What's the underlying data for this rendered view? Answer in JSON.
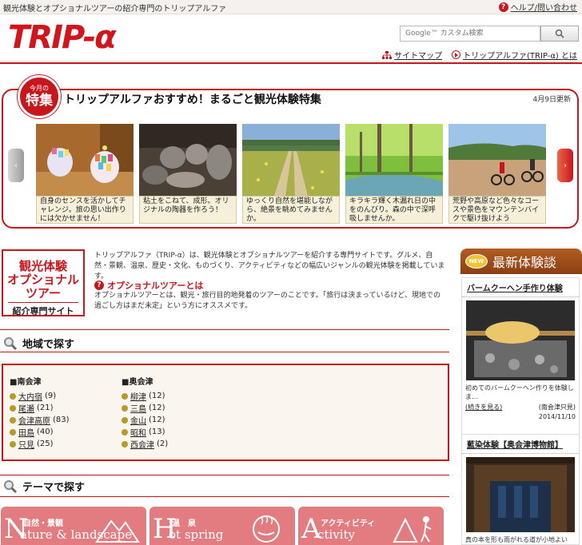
{
  "topbar": {
    "tagline": "観光体験とオプショナルツアーの紹介専門のトリップアルファ",
    "help_label": "ヘルプ/問い合わせ"
  },
  "header": {
    "logo_text": "TRIP-α",
    "search_placeholder": "Google™ カスタム検索",
    "links": [
      "サイトマップ",
      "トリップアルファ(TRIP-α) とは"
    ]
  },
  "feature": {
    "badge_small": "今月の",
    "badge_big": "特集",
    "title": "トリップアルファおすすめ！まるごと観光体験特集",
    "updated": "4月9日更新",
    "slides": [
      {
        "caption": "自身のセンスを活かしてチャレンジ。旅の思い出作りには欠かせません！"
      },
      {
        "caption": "粘土をこねて、成形。オリジナルの陶器を作ろう！"
      },
      {
        "caption": "ゆっくり自然を堪能しながら、絶景を眺めてみませんか。"
      },
      {
        "caption": "キラキラ輝く木漏れ日の中をのんびり。森の中で深呼吸しませんか。"
      },
      {
        "caption": "荒野や高原など色々なコースや景色をマウンテンバイクで駆け抜けよう"
      }
    ]
  },
  "intro": {
    "logo_lines": [
      "観光体験",
      "オプショナル",
      "ツアー",
      "紹介専門サイト"
    ],
    "text": "トリップアルファ（TRIP-α）は、観光体験とオプショナルツアーを紹介する専門サイトです。グルメ、自然・景観、温泉、歴史・文化、ものづくり、アクティビティなどの幅広いジャンルの観光体験を掲載しています。",
    "sub_title": "オプショナルツアーとは",
    "sub_text": "オプショナルツアーとは、観光・旅行目的地発着のツアーのことです。「旅行は決まっているけど、現地での過ごし方はまだ未定」という方にオススメです。"
  },
  "region": {
    "heading": "地域で探す",
    "columns": [
      {
        "title": "■南会津",
        "items": [
          {
            "name": "大内宿",
            "count": "(9)"
          },
          {
            "name": "尾瀬",
            "count": "(21)"
          },
          {
            "name": "会津高原",
            "count": "(83)"
          },
          {
            "name": "田島",
            "count": "(40)"
          },
          {
            "name": "只見",
            "count": "(25)"
          }
        ]
      },
      {
        "title": "■奥会津",
        "items": [
          {
            "name": "柳津",
            "count": "(12)"
          },
          {
            "name": "三島",
            "count": "(12)"
          },
          {
            "name": "金山",
            "count": "(12)"
          },
          {
            "name": "昭和",
            "count": "(13)"
          },
          {
            "name": "西会津",
            "count": "(2)"
          }
        ]
      }
    ]
  },
  "theme": {
    "heading": "テーマで探す",
    "banners": [
      {
        "jp": "自然・景観",
        "cap": "N",
        "en": "ature & landscape"
      },
      {
        "jp": "温　泉",
        "cap": "H",
        "en": "ot spring"
      },
      {
        "jp": "アクティビティ",
        "cap": "A",
        "en": "ctivity"
      }
    ]
  },
  "sidebar": {
    "heading": "最新体験談",
    "badge": "NEW",
    "cards": [
      {
        "title": "バームクーヘン手作り体験",
        "desc": "初めてのバームクーヘン作りを体験しま…",
        "more": "(続きを見る)",
        "place": "(南会津只見)",
        "date": "2014/11/10"
      },
      {
        "title": "藍染体験【奥会津博物館】",
        "desc": "真の本を形も雨がれる道が小地よい"
      }
    ]
  },
  "colors": {
    "accent": "#c8161d",
    "caption_bg": "#f6efd9",
    "region_bg": "#fbf5ef",
    "side_head": "#9c4a18",
    "theme": "#e27c80"
  }
}
